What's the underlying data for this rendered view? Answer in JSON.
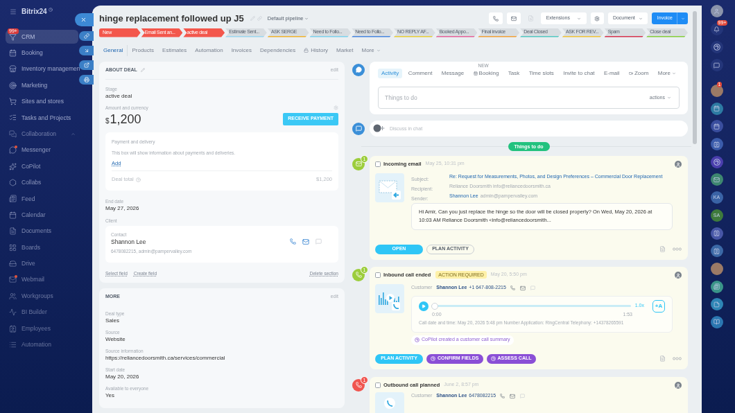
{
  "sidebar": {
    "logo": "Bitrix24",
    "items": [
      {
        "label": "CRM",
        "selected": true,
        "badge": "99+",
        "dot": false
      },
      {
        "label": "Booking",
        "selected": false,
        "dot": false
      },
      {
        "label": "Inventory managemen",
        "selected": false,
        "dot": false
      },
      {
        "label": "Marketing",
        "selected": false,
        "dot": false
      },
      {
        "label": "Sites and stores",
        "selected": false,
        "dot": false
      },
      {
        "label": "Tasks and Projects",
        "selected": false,
        "dot": false
      },
      {
        "label": "Collaboration",
        "selected": false,
        "dot": false,
        "expanded": true
      },
      {
        "label": "Messenger",
        "selected": false,
        "dot": true
      },
      {
        "label": "CoPilot",
        "selected": false,
        "dot": false
      },
      {
        "label": "Collabs",
        "selected": false,
        "dot": false
      },
      {
        "label": "Feed",
        "selected": false,
        "dot": false
      },
      {
        "label": "Calendar",
        "selected": false,
        "dot": false
      },
      {
        "label": "Documents",
        "selected": false,
        "dot": false
      },
      {
        "label": "Boards",
        "selected": false,
        "dot": false
      },
      {
        "label": "Drive",
        "selected": false,
        "dot": false
      },
      {
        "label": "Webmail",
        "selected": false,
        "dot": true
      },
      {
        "label": "Workgroups",
        "selected": false,
        "dot": false
      },
      {
        "label": "BI Builder",
        "selected": false,
        "dot": false
      },
      {
        "label": "Employees",
        "selected": false,
        "dot": false
      },
      {
        "label": "Automation",
        "selected": false,
        "dot": false
      }
    ]
  },
  "header": {
    "title": "hinge replacement followed up J5",
    "pipeline": "Default pipeline"
  },
  "toolbar": {
    "extensions": "Extensions",
    "document": "Document",
    "invoice": "Invoice"
  },
  "stages": [
    {
      "label": "New",
      "color": "#f3574c",
      "reached": true
    },
    {
      "label": "Email Sent an...",
      "color": "#f3574c",
      "reached": true
    },
    {
      "label": "active deal",
      "color": "#f3574c",
      "reached": true
    },
    {
      "label": "Estimate Sent...",
      "color": "#9ed7f0",
      "reached": false
    },
    {
      "label": "ASK SERGE",
      "color": "#f1b42f",
      "reached": false
    },
    {
      "label": "Need to Follo...",
      "color": "#7fd3ee",
      "reached": false
    },
    {
      "label": "Need to Follo...",
      "color": "#4a87e0",
      "reached": false
    },
    {
      "label": "NO REPLY AF...",
      "color": "#e8cf3a",
      "reached": false
    },
    {
      "label": "Booked Appo...",
      "color": "#e7649b",
      "reached": false
    },
    {
      "label": "Final invoice",
      "color": "#f2a23a",
      "reached": false
    },
    {
      "label": "Deal Closed",
      "color": "#55c9c2",
      "reached": false
    },
    {
      "label": "ASK FOR REV...",
      "color": "#f1c43a",
      "reached": false
    },
    {
      "label": "Spam",
      "color": "#d8344f",
      "reached": false
    },
    {
      "label": "Close deal",
      "color": "#86cf3c",
      "reached": false
    }
  ],
  "tabs": [
    {
      "label": "General",
      "selected": true,
      "kind": "plain"
    },
    {
      "label": "Products",
      "selected": false,
      "kind": "plain"
    },
    {
      "label": "Estimates",
      "selected": false,
      "kind": "plain"
    },
    {
      "label": "Automation",
      "selected": false,
      "kind": "plain"
    },
    {
      "label": "Invoices",
      "selected": false,
      "kind": "plain"
    },
    {
      "label": "Dependencies",
      "selected": false,
      "kind": "plain"
    },
    {
      "label": "History",
      "selected": false,
      "kind": "locked"
    },
    {
      "label": "Market",
      "selected": false,
      "kind": "plain"
    },
    {
      "label": "More",
      "selected": false,
      "kind": "menu"
    }
  ],
  "about_deal": {
    "title": "ABOUT DEAL",
    "edit": "edit",
    "stage": {
      "label": "Stage",
      "value": "active deal"
    },
    "amount": {
      "label": "Amount and currency",
      "currency": "$",
      "value": "1,200",
      "button": "RECEIVE PAYMENT"
    },
    "payment": {
      "title": "Payment and delivery",
      "text": "This box will show information about payments and deliveries.",
      "add": "Add",
      "total_label": "Deal total",
      "total": "$1,200"
    },
    "end_date": {
      "label": "End date",
      "value": "May 27, 2026"
    },
    "client": {
      "label": "Client",
      "contact_label": "Contact",
      "name": "Shannon Lee",
      "details": "6478082215, admin@pampervalley.com"
    },
    "links": [
      "Select field",
      "Create field"
    ],
    "delete": "Delete section"
  },
  "more_section": {
    "title": "MORE",
    "edit": "edit",
    "fields": [
      {
        "label": "Deal type",
        "value": "Sales"
      },
      {
        "label": "Source",
        "value": "Website"
      },
      {
        "label": "Source information",
        "value": "https://reliancedoorsmith.ca/services/commercial"
      },
      {
        "label": "Start date",
        "value": "May 20, 2026"
      },
      {
        "label": "Available to everyone",
        "value": "Yes"
      }
    ]
  },
  "composer": {
    "tabs": [
      {
        "label": "Activity",
        "selected": true,
        "kind": "plain"
      },
      {
        "label": "Comment",
        "selected": false,
        "kind": "plain"
      },
      {
        "label": "Message",
        "selected": false,
        "kind": "plain"
      },
      {
        "label": "Booking",
        "selected": false,
        "kind": "new",
        "badge": "NEW"
      },
      {
        "label": "Task",
        "selected": false,
        "kind": "plain"
      },
      {
        "label": "Time slots",
        "selected": false,
        "kind": "plain"
      },
      {
        "label": "Invite to chat",
        "selected": false,
        "kind": "plain"
      },
      {
        "label": "E-mail",
        "selected": false,
        "kind": "plain"
      },
      {
        "label": "Zoom",
        "selected": false,
        "kind": "icon"
      },
      {
        "label": "More",
        "selected": false,
        "kind": "menu"
      }
    ],
    "placeholder": "Things to do",
    "actions": "actions"
  },
  "chat": {
    "placeholder": "Discuss in chat"
  },
  "timeline_label": "Things to do",
  "activities": [
    {
      "kind": "email",
      "checked": false,
      "title": "Incoming email",
      "time": "May 25, 10:31 pm",
      "counter": "1",
      "fields": [
        {
          "label": "Subject:",
          "kind": "link",
          "value": "Re: Request for Measurements, Photos, and Design Preferences – Commercial Door Replacement"
        },
        {
          "label": "Recipient:",
          "kind": "plain",
          "value": "Reliance Doorsmith info@reliancedoorsmith.ca"
        },
        {
          "label": "Sender:",
          "kind": "person",
          "name": "Shannon Lee",
          "value": "admin@pampervalley.com"
        }
      ],
      "message": "Hi Amir, Can you just replace the hinge so the door will be closed properly? On Wed, May 20, 2026 at 10:03 AM Reliance Doorsmith <info@reliancedoorsmith...",
      "buttons": [
        {
          "label": "OPEN",
          "kind": "primary"
        },
        {
          "label": "PLAN ACTIVITY",
          "kind": "secondary"
        }
      ]
    },
    {
      "kind": "inbound_call",
      "checked": false,
      "title": "Inbound call ended",
      "tag": "ACTION REQUIRED",
      "time": "May 20, 5:50 pm",
      "counter": "1",
      "customer": {
        "label": "Customer",
        "name": "Shannon Lee",
        "phone": "+1 647-808-2215"
      },
      "player": {
        "level": 0,
        "start": "0:00",
        "end": "1:53",
        "speed": "1.0x",
        "transcribe": "+A"
      },
      "call_info": "Call date and time: May 20, 2026 5:48 pm Number Application: RingCentral Telephony: +14378265591",
      "summary": "CoPilot created a customer call summary",
      "buttons": [
        {
          "label": "PLAN ACTIVITY",
          "kind": "primary"
        },
        {
          "label": "CONFIRM FIELDS",
          "kind": "copilot"
        },
        {
          "label": "ASSESS CALL",
          "kind": "copilot"
        }
      ]
    },
    {
      "kind": "outbound_call",
      "checked": false,
      "title": "Outbound call planned",
      "time": "June 2, 8:57 pm",
      "counter": "1",
      "customer": {
        "label": "Customer",
        "name": "Shannon Lee",
        "phone": "6478082215"
      }
    }
  ],
  "right_bar": {
    "top": [
      {
        "kind": "user"
      },
      {
        "kind": "bell",
        "badge": "99+"
      },
      {
        "kind": "swirl"
      },
      {
        "kind": "chat"
      }
    ],
    "apps": [
      {
        "kind": "photo",
        "badge": "1"
      },
      {
        "kind": "calendar",
        "color": "#2d7ba3"
      },
      {
        "kind": "calendar",
        "color": "#3a4e9e"
      },
      {
        "kind": "contact",
        "color": "#3b5cab"
      },
      {
        "kind": "swirl",
        "color": "#4a3ead"
      },
      {
        "kind": "mail",
        "color": "#3e8770"
      },
      {
        "kind": "initials",
        "text": "KA",
        "color": "#3a63a6"
      },
      {
        "kind": "initials",
        "text": "SA",
        "color": "#3e7a3c"
      },
      {
        "kind": "contact",
        "color": "#4756a6"
      },
      {
        "kind": "contact",
        "color": "#3b68a6"
      },
      {
        "kind": "photo"
      },
      {
        "kind": "news",
        "color": "#3a9589"
      },
      {
        "kind": "notes",
        "color": "#2e85b5"
      },
      {
        "kind": "book",
        "color": "#2b77b1"
      }
    ]
  }
}
